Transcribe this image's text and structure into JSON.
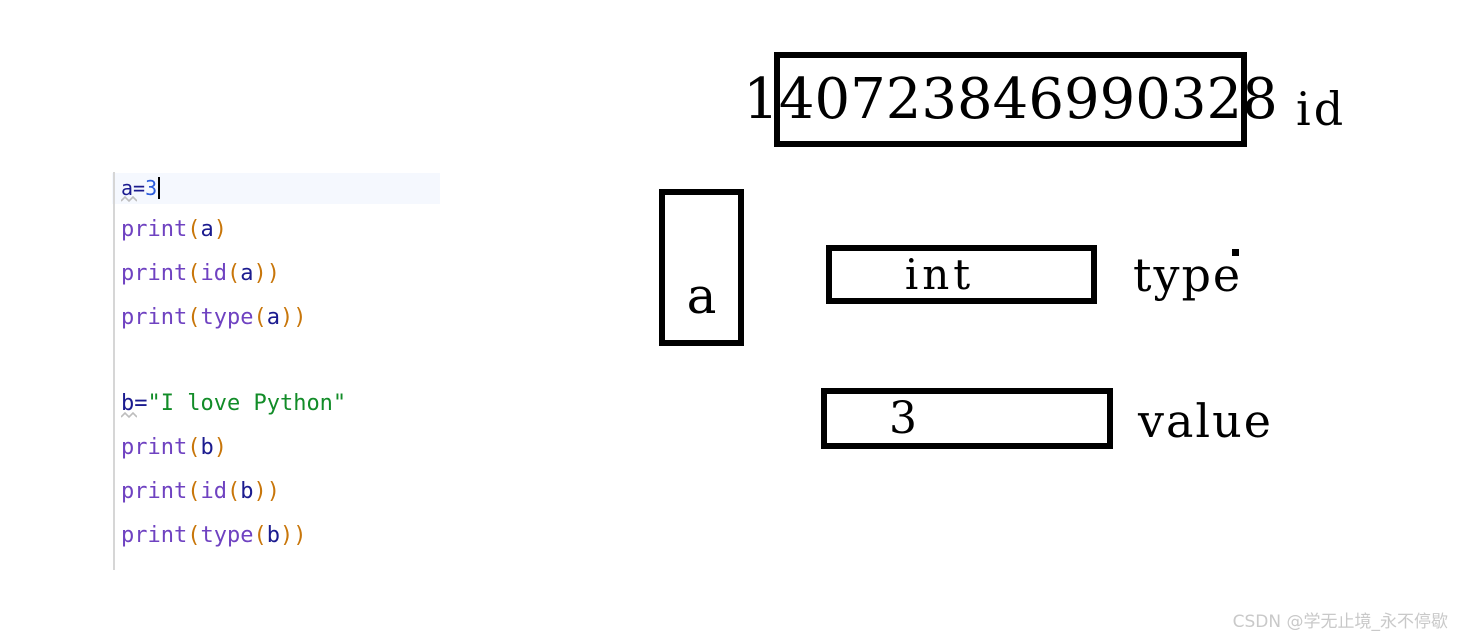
{
  "editor": {
    "language": "python",
    "cursor_line": 1,
    "colors": {
      "variable": "#1b1b8f",
      "number": "#2a5bdc",
      "function": "#6f42c1",
      "paren": "#c8760a",
      "string": "#128c28",
      "current_line_background": "#f5f8fe",
      "indent_guide": "#d6d6d6"
    },
    "lines": [
      {
        "id": "line-1",
        "highlighted": true,
        "has_caret": true,
        "has_squiggle": true,
        "tokens": [
          {
            "text": "a",
            "type": "var"
          },
          {
            "text": "=",
            "type": "op"
          },
          {
            "text": "3",
            "type": "num"
          }
        ]
      },
      {
        "id": "line-2",
        "highlighted": false,
        "has_caret": false,
        "has_squiggle": false,
        "tokens": [
          {
            "text": "print",
            "type": "func"
          },
          {
            "text": "(",
            "type": "paren"
          },
          {
            "text": "a",
            "type": "var"
          },
          {
            "text": ")",
            "type": "paren"
          }
        ]
      },
      {
        "id": "line-3",
        "highlighted": false,
        "has_caret": false,
        "has_squiggle": false,
        "tokens": [
          {
            "text": "print",
            "type": "func"
          },
          {
            "text": "(",
            "type": "paren"
          },
          {
            "text": "id",
            "type": "func"
          },
          {
            "text": "(",
            "type": "paren"
          },
          {
            "text": "a",
            "type": "var"
          },
          {
            "text": ")",
            "type": "paren"
          },
          {
            "text": ")",
            "type": "paren"
          }
        ]
      },
      {
        "id": "line-4",
        "highlighted": false,
        "has_caret": false,
        "has_squiggle": false,
        "tokens": [
          {
            "text": "print",
            "type": "func"
          },
          {
            "text": "(",
            "type": "paren"
          },
          {
            "text": "type",
            "type": "func"
          },
          {
            "text": "(",
            "type": "paren"
          },
          {
            "text": "a",
            "type": "var"
          },
          {
            "text": ")",
            "type": "paren"
          },
          {
            "text": ")",
            "type": "paren"
          }
        ]
      },
      {
        "id": "line-5",
        "highlighted": false,
        "has_caret": false,
        "has_squiggle": false,
        "tokens": []
      },
      {
        "id": "line-6",
        "highlighted": false,
        "has_caret": false,
        "has_squiggle": true,
        "tokens": [
          {
            "text": "b",
            "type": "var"
          },
          {
            "text": "=",
            "type": "op"
          },
          {
            "text": "\"I love Python\"",
            "type": "str"
          }
        ]
      },
      {
        "id": "line-7",
        "highlighted": false,
        "has_caret": false,
        "has_squiggle": false,
        "tokens": [
          {
            "text": "print",
            "type": "func"
          },
          {
            "text": "(",
            "type": "paren"
          },
          {
            "text": "b",
            "type": "var"
          },
          {
            "text": ")",
            "type": "paren"
          }
        ]
      },
      {
        "id": "line-8",
        "highlighted": false,
        "has_caret": false,
        "has_squiggle": false,
        "tokens": [
          {
            "text": "print",
            "type": "func"
          },
          {
            "text": "(",
            "type": "paren"
          },
          {
            "text": "id",
            "type": "func"
          },
          {
            "text": "(",
            "type": "paren"
          },
          {
            "text": "b",
            "type": "var"
          },
          {
            "text": ")",
            "type": "paren"
          },
          {
            "text": ")",
            "type": "paren"
          }
        ]
      },
      {
        "id": "line-9",
        "highlighted": false,
        "has_caret": false,
        "has_squiggle": false,
        "tokens": [
          {
            "text": "print",
            "type": "func"
          },
          {
            "text": "(",
            "type": "paren"
          },
          {
            "text": "type",
            "type": "func"
          },
          {
            "text": "(",
            "type": "paren"
          },
          {
            "text": "b",
            "type": "var"
          },
          {
            "text": ")",
            "type": "paren"
          },
          {
            "text": ")",
            "type": "paren"
          }
        ]
      }
    ]
  },
  "diagram": {
    "id_box_value": "140723846990328",
    "id_label": "id",
    "variable_box_value": "a",
    "type_box_value": "int",
    "type_label": "type",
    "value_box_value": "3",
    "value_label": "value",
    "border_color": "#000000",
    "box_background": "#ffffff"
  },
  "watermark": {
    "text": "CSDN @学无止境_永不停歇",
    "color": "#c9c9c9"
  }
}
